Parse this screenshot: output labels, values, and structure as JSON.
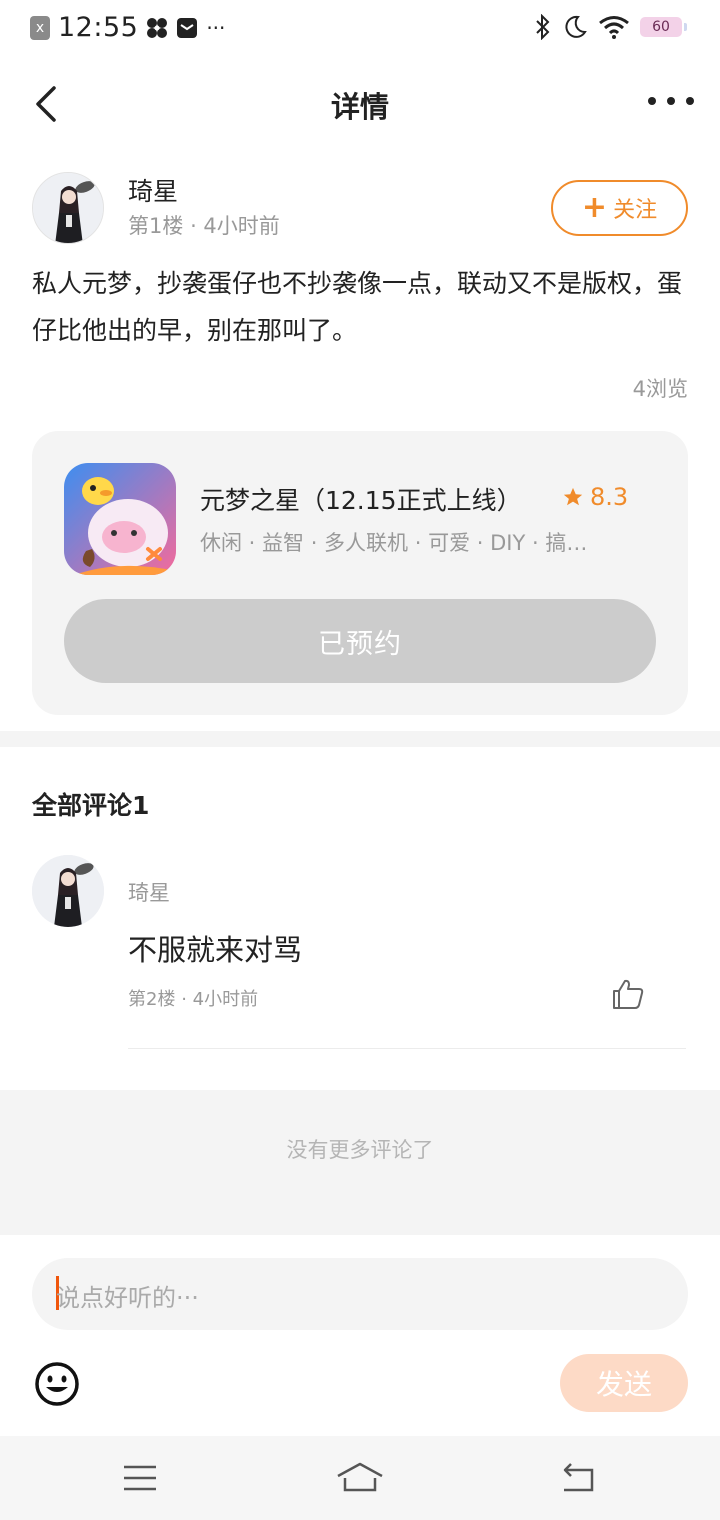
{
  "status_bar": {
    "time": "12:55",
    "notification_glyph": "x",
    "overflow": "···",
    "battery": "60",
    "icons": [
      "close-notification-icon",
      "pinwheel-icon",
      "mail-icon",
      "bluetooth-icon",
      "moon-icon",
      "wifi-icon",
      "battery-icon"
    ]
  },
  "header": {
    "title": "详情",
    "back_icon": "chevron-left-icon",
    "more_icon": "more-dots-icon"
  },
  "post": {
    "author": "琦星",
    "floor": "第1楼",
    "time": "4小时前",
    "follow_plus": "+",
    "follow_label": "关注",
    "content": "私人元梦，抄袭蛋仔也不抄袭像一点，联动又不是版权，蛋仔比他出的早，别在那叫了。",
    "views": "4浏览"
  },
  "game_card": {
    "name": "元梦之星（12.15正式上线）",
    "rating": "8.3",
    "tags": "休闲 · 益智 · 多人联机 · 可爱 · DIY · 搞…",
    "button_label": "已预约"
  },
  "comments": {
    "title": "全部评论1",
    "items": [
      {
        "author": "琦星",
        "text": "不服就来对骂",
        "floor": "第2楼",
        "time": "4小时前"
      }
    ],
    "no_more": "没有更多评论了"
  },
  "composer": {
    "placeholder": "说点好听的···",
    "send_label": "发送"
  },
  "colors": {
    "accent": "#f08b2b",
    "send_disabled": "#fddac6",
    "reserved_button": "#cccccc",
    "caret": "#f0560c"
  },
  "nav_bar": {
    "icons": [
      "menu-icon",
      "home-icon",
      "back-icon"
    ]
  }
}
